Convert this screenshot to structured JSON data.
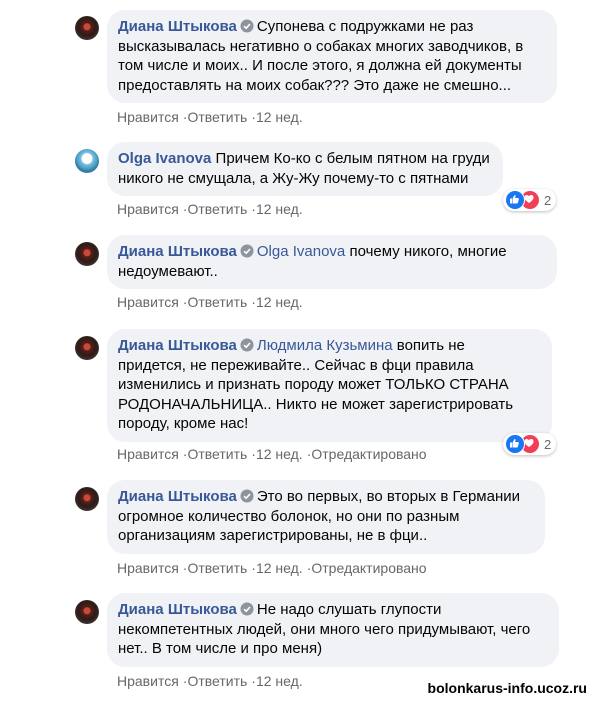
{
  "comments": [
    {
      "author": "Диана Штыкова",
      "lines": [
        "Супонева с подружками не раз",
        "высказывалась негативно о собаках многих заводчиков, в",
        "том числе и моих.. И после этого, я должна ей документы",
        "предоставлять на моих собак??? Это даже не смешно..."
      ],
      "like": "Нравится",
      "reply": "Ответить",
      "time": "12 нед."
    },
    {
      "author": "Olga Ivanova",
      "lines": [
        "Причем Ко-ко с белым пятном на груди",
        "никого не смущала, а Жу-Жу почему-то с пятнами"
      ],
      "like": "Нравится",
      "reply": "Ответить",
      "time": "12 нед.",
      "reactions": "2"
    },
    {
      "author": "Диана Штыкова",
      "mention": "Olga Ivanova",
      "lines": [
        "почему никого, многие",
        "недоумевают.."
      ],
      "like": "Нравится",
      "reply": "Ответить",
      "time": "12 нед."
    },
    {
      "author": "Диана Штыкова",
      "mention": "Людмила Кузьмина",
      "lines": [
        "вопить не",
        "придется, не переживайте.. Сейчас в фци правила",
        "изменились и признать породу может ТОЛЬКО СТРАНА",
        "РОДОНАЧАЛЬНИЦА.. Никто не может зарегистрировать",
        "породу, кроме нас!"
      ],
      "like": "Нравится",
      "reply": "Ответить",
      "time": "12 нед.",
      "edited": "Отредактировано",
      "reactions": "2"
    },
    {
      "author": "Диана Штыкова",
      "lines": [
        "Это во первых, во вторых в Германии",
        "огромное количество болонок, но они по разным",
        "организациям зарегистрированы, не в фци.."
      ],
      "like": "Нравится",
      "reply": "Ответить",
      "time": "12 нед.",
      "edited": "Отредактировано"
    },
    {
      "author": "Диана Штыкова",
      "lines": [
        "Не надо слушать глупости",
        "некомпетентных людей, они много чего придумывают, чего",
        "нет.. В том числе и про меня)"
      ],
      "like": "Нравится",
      "reply": "Ответить",
      "time": "12 нед."
    }
  ],
  "separator": "·",
  "watermark": "bolonkarus-info.ucoz.ru",
  "colors": {
    "author": "#385898",
    "bubble": "#f0f2f5",
    "meta": "#65676b",
    "like": "#1877f2",
    "love": "#f33e58"
  },
  "icons": {
    "badge": "shield-badge-icon",
    "like": "thumbs-up-icon",
    "love": "heart-icon"
  }
}
